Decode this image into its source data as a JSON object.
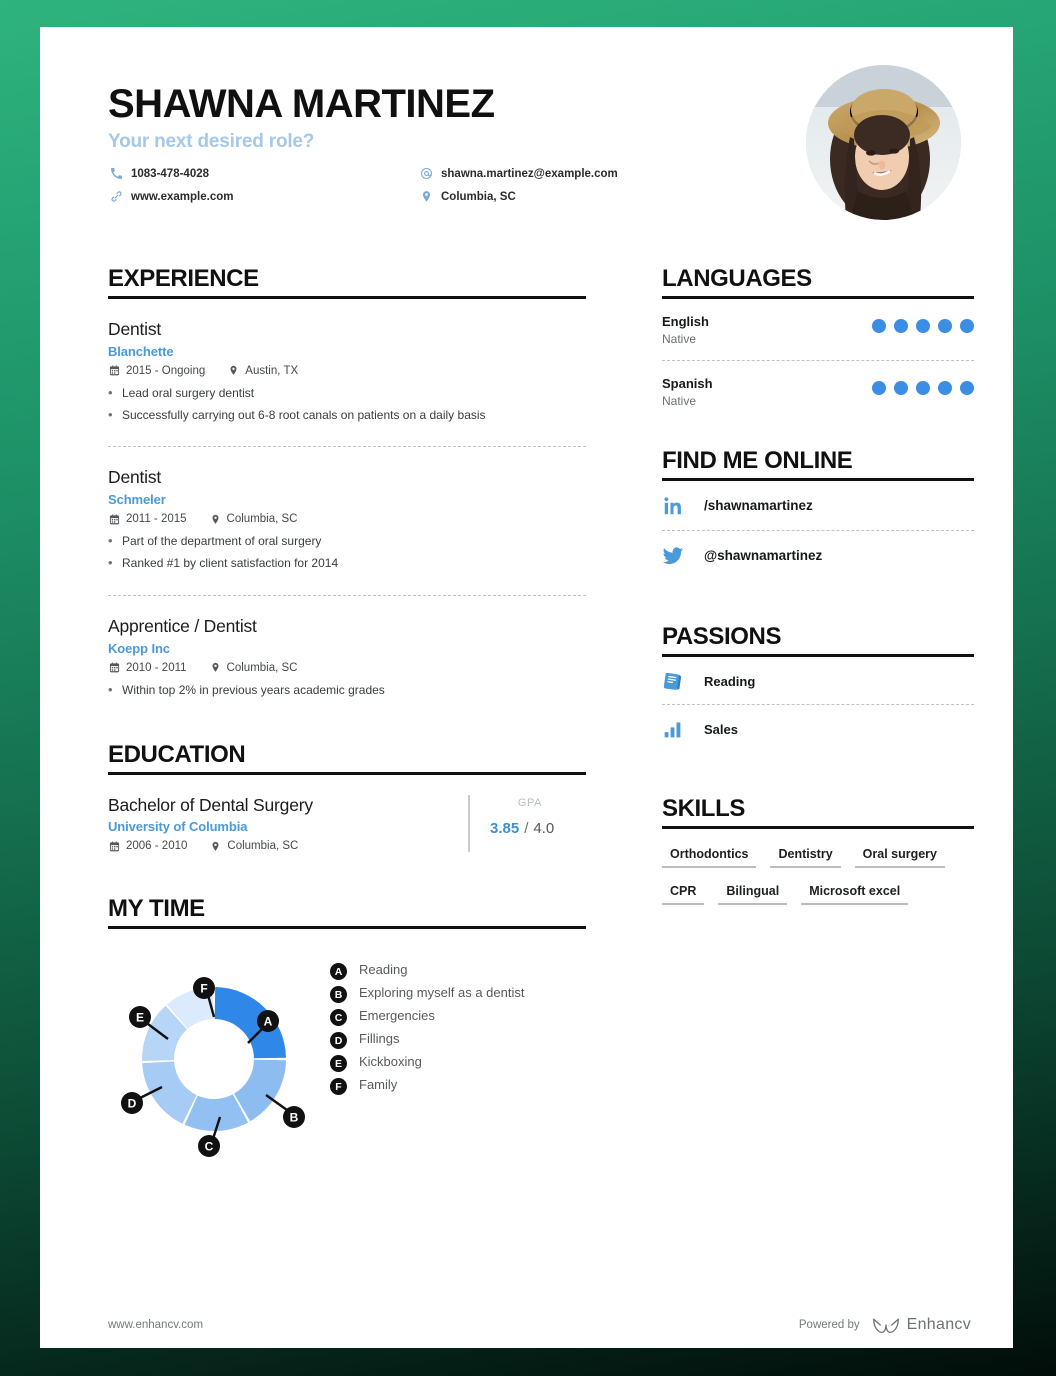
{
  "header": {
    "full_name": "SHAWNA MARTINEZ",
    "role_subtitle": "Your next desired role?",
    "contacts": [
      {
        "icon": "phone-icon",
        "value": "1083-478-4028"
      },
      {
        "icon": "at-icon",
        "value": "shawna.martinez@example.com"
      },
      {
        "icon": "link-icon",
        "value": "www.example.com"
      },
      {
        "icon": "location-pin-icon",
        "value": "Columbia, SC"
      }
    ],
    "photo_alt": "Smiling woman wearing a straw hat"
  },
  "experience": {
    "heading": "EXPERIENCE",
    "entries": [
      {
        "title": "Dentist",
        "organization": "Blanchette",
        "dates": "2015 - Ongoing",
        "location": "Austin, TX",
        "bullets": [
          "Lead oral surgery dentist",
          "Successfully carrying out 6-8 root canals on patients on a daily basis"
        ]
      },
      {
        "title": "Dentist",
        "organization": "Schmeler",
        "dates": "2011 - 2015",
        "location": "Columbia, SC",
        "bullets": [
          "Part of the department of oral surgery",
          "Ranked #1 by client satisfaction for 2014"
        ]
      },
      {
        "title": "Apprentice / Dentist",
        "organization": "Koepp Inc",
        "dates": "2010 - 2011",
        "location": "Columbia, SC",
        "bullets": [
          "Within top 2% in previous years academic grades"
        ]
      }
    ]
  },
  "education": {
    "heading": "EDUCATION",
    "entries": [
      {
        "degree": "Bachelor of Dental Surgery",
        "institution": "University of Columbia",
        "dates": "2006 - 2010",
        "location": "Columbia, SC",
        "gpa_label": "GPA",
        "gpa_score": "3.85",
        "gpa_separator": "/",
        "gpa_max": "4.0"
      }
    ]
  },
  "my_time": {
    "heading": "MY TIME",
    "legend": [
      {
        "key": "A",
        "label": "Reading"
      },
      {
        "key": "B",
        "label": "Exploring myself as a dentist"
      },
      {
        "key": "C",
        "label": "Emergencies"
      },
      {
        "key": "D",
        "label": "Fillings"
      },
      {
        "key": "E",
        "label": "Kickboxing"
      },
      {
        "key": "F",
        "label": "Family"
      }
    ]
  },
  "chart_data": {
    "type": "pie",
    "title": "MY TIME",
    "subtype": "donut",
    "categories": [
      "Reading",
      "Exploring myself as a dentist",
      "Emergencies",
      "Fillings",
      "Kickboxing",
      "Family"
    ],
    "keys": [
      "A",
      "B",
      "C",
      "D",
      "E",
      "F"
    ],
    "values": [
      25,
      17,
      15,
      17,
      15,
      11
    ],
    "unit": "percent",
    "colors": [
      "#2f87e8",
      "#8dbdf0",
      "#92c0f2",
      "#a6cbf4",
      "#b6d5f7",
      "#dbeaFC"
    ],
    "legend_position": "right",
    "grid": false
  },
  "languages": {
    "heading": "LANGUAGES",
    "max_dots": 5,
    "items": [
      {
        "name": "English",
        "level": "Native",
        "dots": 5
      },
      {
        "name": "Spanish",
        "level": "Native",
        "dots": 5
      }
    ]
  },
  "find_me_online": {
    "heading": "FIND ME ONLINE",
    "items": [
      {
        "icon": "linkedin-icon",
        "handle": "/shawnamartinez"
      },
      {
        "icon": "twitter-icon",
        "handle": "@shawnamartinez"
      }
    ]
  },
  "passions": {
    "heading": "PASSIONS",
    "items": [
      {
        "icon": "book-icon",
        "label": "Reading"
      },
      {
        "icon": "bar-chart-icon",
        "label": "Sales"
      }
    ]
  },
  "skills": {
    "heading": "SKILLS",
    "items": [
      "Orthodontics",
      "Dentistry",
      "Oral surgery",
      "CPR",
      "Bilingual",
      "Microsoft excel"
    ]
  },
  "footer": {
    "url": "www.enhancv.com",
    "powered_by": "Powered by",
    "brand": "Enhancv"
  },
  "theme": {
    "accent_blue": "#4a9ada",
    "dot_blue": "#3c8de4",
    "subtitle_blue": "#a6c8e8",
    "heading_black": "#111111",
    "background_green": "#2fb37c"
  }
}
